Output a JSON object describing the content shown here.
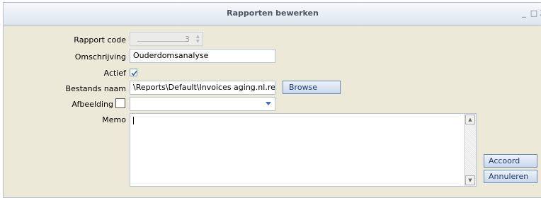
{
  "window": {
    "title": "Rapporten bewerken",
    "controls": {
      "minimize": "_",
      "maximize": "□",
      "close": "X"
    }
  },
  "form": {
    "rapport_code": {
      "label": "Rapport code",
      "value": "3"
    },
    "omschrijving": {
      "label": "Omschrijving",
      "value": "Ouderdomsanalyse"
    },
    "actief": {
      "label": "Actief",
      "checked": true
    },
    "bestands_naam": {
      "label": "Bestands naam",
      "value": "\\Reports\\Default\\Invoices aging.nl.rep"
    },
    "browse_label": "Browse",
    "afbeelding": {
      "label": "Afbeelding",
      "value": ""
    },
    "memo": {
      "label": "Memo",
      "value": ""
    }
  },
  "buttons": {
    "accoord": "Accoord",
    "annuleren": "Annuleren"
  },
  "colors": {
    "accent": "#1f3d6e",
    "button_border": "#6c8cb8",
    "field_border": "#b7c4d6",
    "window_bg": "#ece9d8"
  }
}
